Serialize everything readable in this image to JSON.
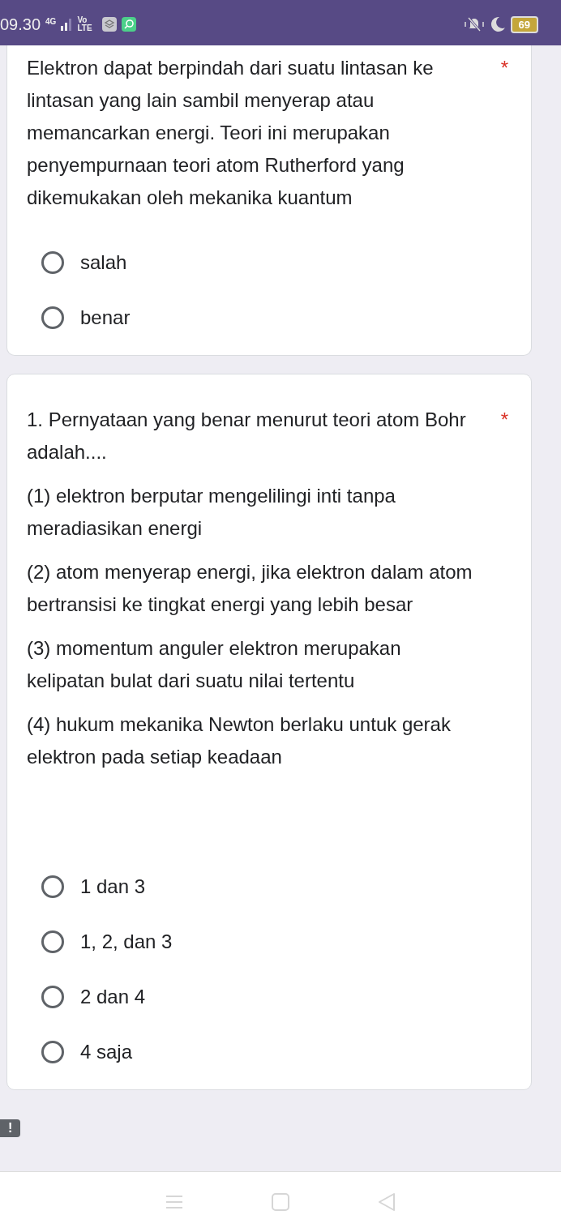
{
  "status_bar": {
    "time": "09.30",
    "network": "4G",
    "volte_top": "Vo",
    "volte_bottom": "LTE",
    "battery": "69"
  },
  "questions": [
    {
      "title": "Elektron dapat berpindah dari suatu lintasan ke lintasan yang lain sambil menyerap atau memancarkan energi. Teori ini merupakan penyempurnaan teori atom Rutherford yang dikemukakan oleh mekanika kuantum",
      "required_mark": "*",
      "options": [
        {
          "label": "salah",
          "selected": false
        },
        {
          "label": "benar",
          "selected": false
        }
      ]
    },
    {
      "title": "1. Pernyataan yang benar menurut teori atom Bohr adalah....",
      "required_mark": "*",
      "paragraphs": [
        "(1) elektron berputar mengelilingi inti tanpa meradiasikan energi",
        "(2) atom menyerap energi, jika elektron dalam atom bertransisi ke tingkat energi yang lebih besar",
        "(3) momentum anguler elektron merupakan kelipatan bulat dari suatu nilai tertentu",
        "(4) hukum mekanika Newton berlaku untuk gerak elektron pada setiap keadaan"
      ],
      "options": [
        {
          "label": "1 dan 3",
          "selected": false
        },
        {
          "label": "1, 2, dan 3",
          "selected": false
        },
        {
          "label": "2 dan 4",
          "selected": false
        },
        {
          "label": "4 saja",
          "selected": false
        }
      ]
    }
  ],
  "feedback_badge": "!"
}
